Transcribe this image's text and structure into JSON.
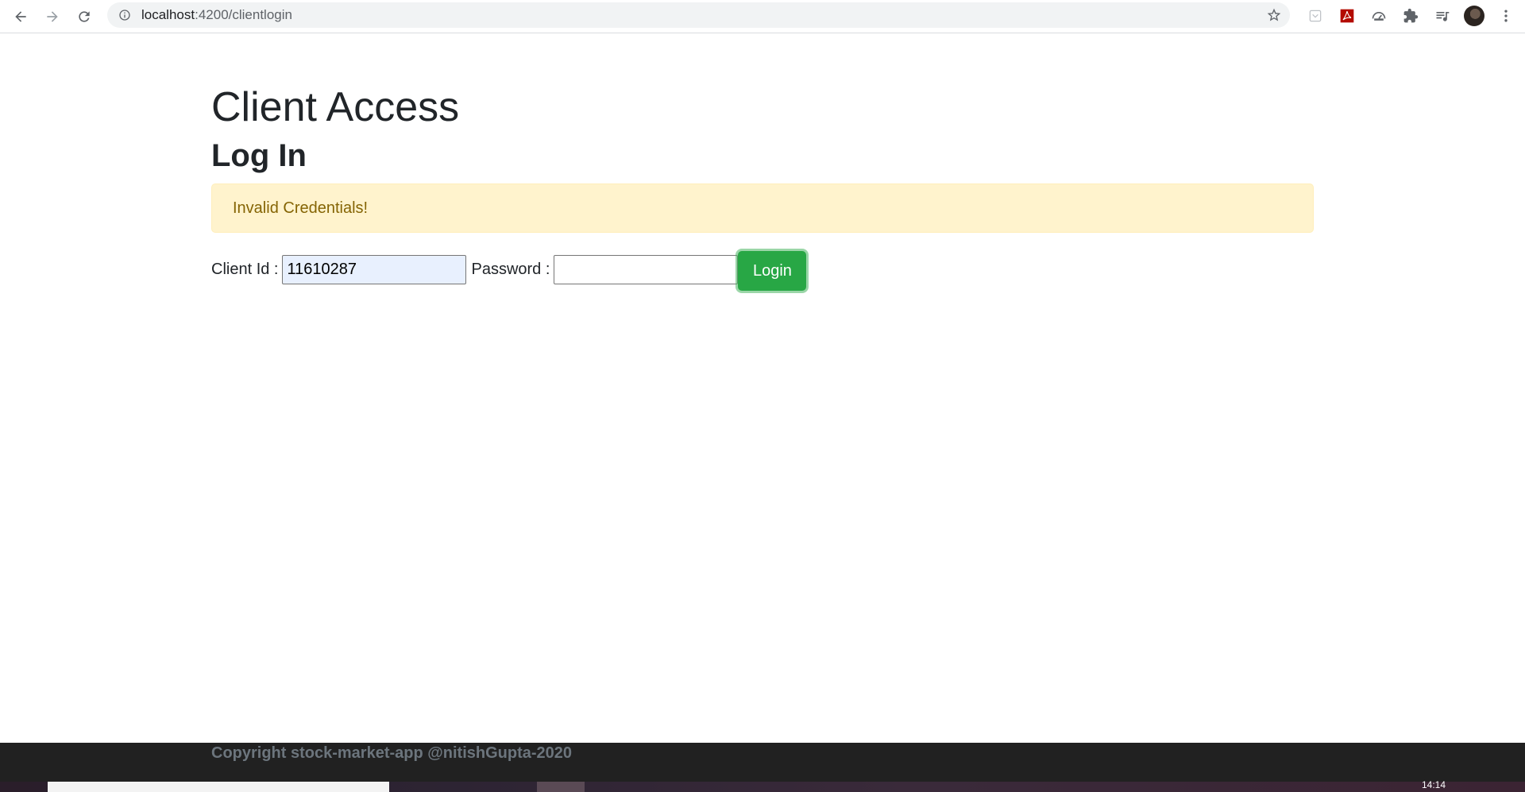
{
  "browser": {
    "url_prefix": "localhost",
    "url_rest": ":4200/clientlogin",
    "icons": {
      "back": "back-arrow-icon",
      "forward": "forward-arrow-icon",
      "reload": "reload-icon",
      "site_info": "info-icon",
      "bookmark": "star-icon"
    },
    "extensions": [
      "pocket-icon",
      "acrobat-icon",
      "speedometer-icon",
      "puzzle-icon",
      "media-playlist-icon"
    ],
    "menu_icon": "kebab-menu-icon"
  },
  "page": {
    "title": "Client Access",
    "subtitle": "Log In",
    "alert": {
      "text": "Invalid Credentials!",
      "color": "#856404",
      "background": "#fff3cd"
    },
    "form": {
      "client_id_label": "Client Id :",
      "client_id_value": "11610287",
      "password_label": "Password :",
      "password_value": "",
      "login_label": "Login",
      "login_color": "#28a745"
    }
  },
  "footer": {
    "copyright": "Copyright stock-market-app @nitishGupta-2020"
  },
  "taskbar": {
    "clock": "14:14"
  }
}
